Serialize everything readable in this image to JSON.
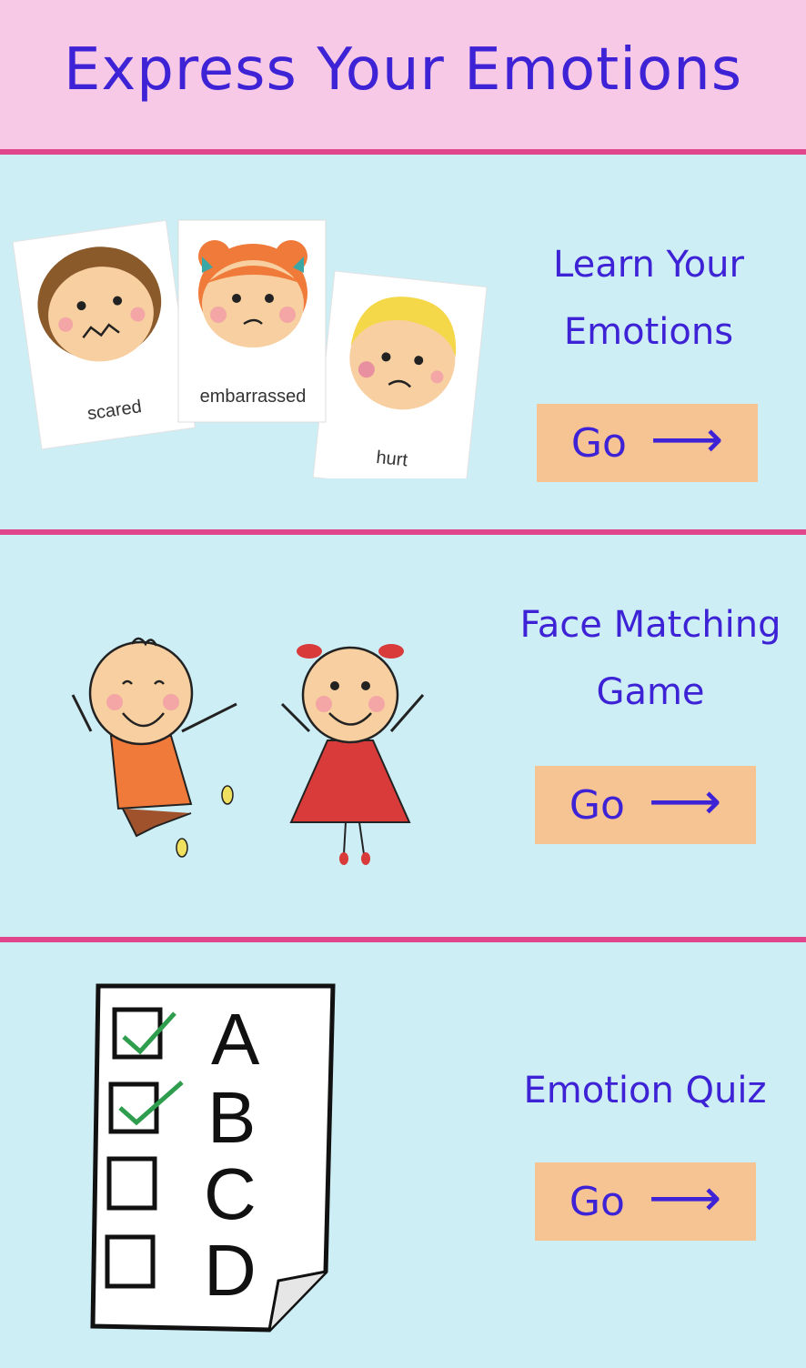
{
  "header": {
    "title": "Express Your Emotions"
  },
  "sections": [
    {
      "title_line1": "Learn Your",
      "title_line2": "Emotions",
      "button_label": "Go",
      "button_arrow": "⟶",
      "cards": [
        "scared",
        "embarrassed",
        "hurt"
      ]
    },
    {
      "title_line1": "Face Matching",
      "title_line2": "Game",
      "button_label": "Go",
      "button_arrow": "⟶"
    },
    {
      "title_line1": "Emotion Quiz",
      "button_label": "Go",
      "button_arrow": "⟶",
      "quiz_options": [
        "A",
        "B",
        "C",
        "D"
      ]
    }
  ],
  "colors": {
    "accent_text": "#3d22d6",
    "header_bg": "#f7c9e6",
    "divider": "#e0468c",
    "section_bg": "#cdeef5",
    "button_bg": "#f6c493"
  }
}
